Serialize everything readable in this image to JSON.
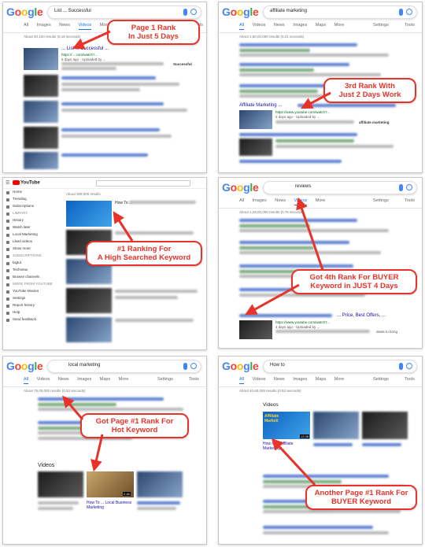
{
  "logo_letters": [
    "G",
    "o",
    "o",
    "g",
    "l",
    "e"
  ],
  "colors": {
    "callout": "#e8332a",
    "google_blue": "#4285f4",
    "link": "#1a0dab"
  },
  "panel1": {
    "query": "List ... Successful",
    "tabs": [
      "All",
      "Images",
      "News",
      "Videos",
      "More"
    ],
    "active_tab": "Videos",
    "tools": "Tools",
    "stats": "About 40,100 results (0.18 seconds)",
    "result_title": "... List ... Successful ...",
    "result_url": "https://... com/watch?...",
    "result_meta": "5 days ago - Uploaded by ...",
    "result_meta2": "Successful",
    "callout": "Page 1 Rank\nIn Just 5 Days"
  },
  "panel2": {
    "query": "affiliate marketing",
    "tabs": [
      "All",
      "Videos",
      "News",
      "Images",
      "Maps",
      "More"
    ],
    "active_tab": "All",
    "settings": "Settings",
    "tools": "Tools",
    "stats": "About 1,60,00,000 results (0.21 seconds)",
    "result_title": "Affiliate Marketing ...",
    "result_url": "https://www.youtube.com/watch?...",
    "result_meta": "2 days ago - Uploaded by ...",
    "result_meta2": "affiliate marketing",
    "callout": "3rd Rank With\nJust 2 Days Work"
  },
  "panel3": {
    "logo": "YouTube",
    "stats": "About 308,000 results",
    "result_title": "How To ...",
    "sidebar": [
      "Home",
      "Trending",
      "Subscriptions",
      "LIBRARY",
      "History",
      "Watch later",
      "Local Marketing",
      "Liked videos",
      "Show more",
      "SUBSCRIPTIONS",
      "bigtut",
      "TechView",
      "Browse channels",
      "MORE FROM YOUTUBE",
      "YouTube Movies",
      "Settings",
      "Report history",
      "Help",
      "Send feedback"
    ],
    "callout": "#1 Ranking For\nA High Searched Keyword"
  },
  "panel4": {
    "query": "reviews",
    "tabs": [
      "All",
      "Images",
      "News",
      "Videos",
      "More"
    ],
    "settings": "Settings",
    "tools": "Tools",
    "stats": "About 1,29,00,000 results (0.76 seconds)",
    "result_title": "... Price, Best Offers, ...",
    "result_url": "https://www.youtube.com/watch?...",
    "result_meta": "4 days ago - Uploaded by ...",
    "result_meta2": "deals to bring",
    "callout": "Got 4th Rank For BUYER\nKeyword in JUST 4 Days"
  },
  "panel5": {
    "query": "local marketing",
    "tabs": [
      "All",
      "Videos",
      "News",
      "Images",
      "Maps",
      "More"
    ],
    "active_tab": "All",
    "settings": "Settings",
    "tools": "Tools",
    "stats": "About 75,00,000 results (0.53 seconds)",
    "videos_heading": "Videos",
    "card_title": "How To ... Local Business Marketing",
    "card_duration": "2:46",
    "callout": "Got Page #1 Rank For\nHot  Keyword"
  },
  "panel6": {
    "query": "How to",
    "tabs": [
      "All",
      "Videos",
      "News",
      "Images",
      "Maps",
      "More"
    ],
    "active_tab": "All",
    "settings": "Settings",
    "tools": "Tools",
    "stats": "About 40,60,000 results (0.53 seconds)",
    "videos_heading": "Videos",
    "card_thumb_text": "Affiliate Marketi",
    "card_title": "How to ... Affiliate Marketing ...",
    "card_duration": "12:38",
    "callout": "Another Page #1 Rank For\nBUYER Keyword"
  }
}
